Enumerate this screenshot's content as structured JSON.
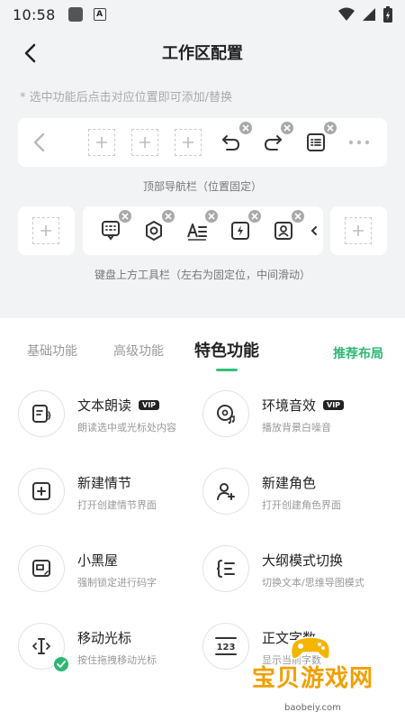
{
  "status_bar": {
    "time": "10:58",
    "a_label": "A"
  },
  "header": {
    "title": "工作区配置"
  },
  "hint": "* 选中功能后点击对应位置即可添加/替换",
  "top_nav": {
    "caption": "顶部导航栏（位置固定）"
  },
  "keyboard_bar": {
    "caption": "键盘上方工具栏（左右为固定位，中间滑动）"
  },
  "tabs": [
    {
      "label": "基础功能"
    },
    {
      "label": "高级功能"
    },
    {
      "label": "特色功能"
    }
  ],
  "active_tab_index": 2,
  "recommend_label": "推荐布局",
  "vip_label": "VIP",
  "features": [
    {
      "title": "文本朗读",
      "subtitle": "朗读选中或光标处内容",
      "icon": "read-aloud-icon",
      "vip": true
    },
    {
      "title": "环境音效",
      "subtitle": "播放背景白噪音",
      "icon": "ambient-sound-icon",
      "vip": true
    },
    {
      "title": "新建情节",
      "subtitle": "打开创建情节界面",
      "icon": "new-plot-icon",
      "vip": false
    },
    {
      "title": "新建角色",
      "subtitle": "打开创建角色界面",
      "icon": "new-character-icon",
      "vip": false
    },
    {
      "title": "小黑屋",
      "subtitle": "强制锁定进行码字",
      "icon": "dark-room-icon",
      "vip": false
    },
    {
      "title": "大纲模式切换",
      "subtitle": "切换文本/思维导图模式",
      "icon": "outline-mode-icon",
      "vip": false
    },
    {
      "title": "移动光标",
      "subtitle": "按住拖拽移动光标",
      "icon": "move-cursor-icon",
      "vip": false,
      "selected": true
    },
    {
      "title": "正文字数",
      "subtitle": "显示当前字数",
      "icon": "word-count-icon",
      "vip": false
    }
  ],
  "watermark": {
    "text": "宝贝游戏网",
    "url": "baobeiy.com"
  },
  "colors": {
    "accent": "#2cb872",
    "background": "#f2f3f5",
    "badge": "#a9a9a9"
  }
}
